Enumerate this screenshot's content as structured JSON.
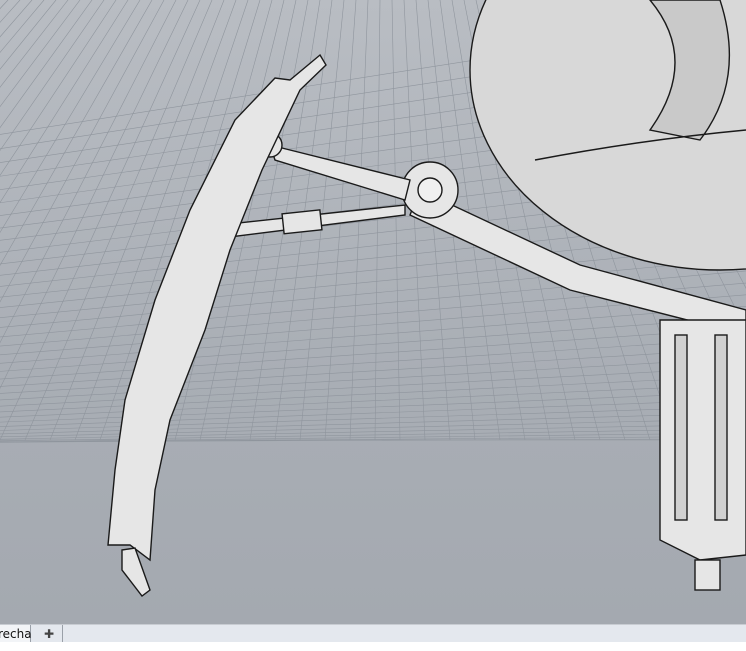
{
  "viewport_tabs": [
    {
      "label": "recha",
      "active": true
    }
  ],
  "add_tab_icon": "plus-icon",
  "colors": {
    "viewport_bg": "#b0b4ba",
    "grid": "#8f959d",
    "model_fill": "#e8e8e8",
    "model_edge": "#1a1a1a"
  }
}
